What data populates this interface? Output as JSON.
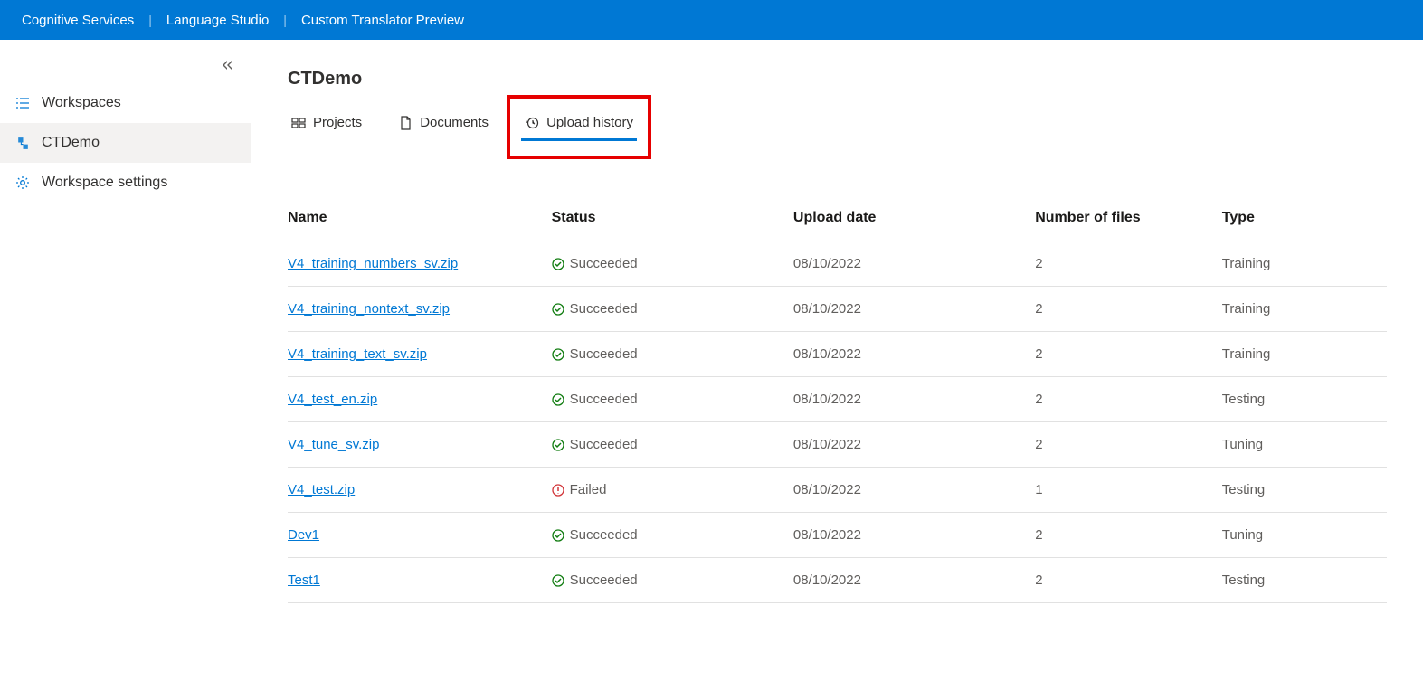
{
  "topbar": {
    "links": [
      "Cognitive Services",
      "Language Studio",
      "Custom Translator Preview"
    ]
  },
  "sidebar": {
    "items": [
      {
        "label": "Workspaces",
        "icon": "list"
      },
      {
        "label": "CTDemo",
        "icon": "translate",
        "active": true
      },
      {
        "label": "Workspace settings",
        "icon": "gear"
      }
    ]
  },
  "page": {
    "title": "CTDemo"
  },
  "tabs": [
    {
      "label": "Projects",
      "icon": "projects"
    },
    {
      "label": "Documents",
      "icon": "documents"
    },
    {
      "label": "Upload history",
      "icon": "history",
      "active": true,
      "highlighted": true
    }
  ],
  "table": {
    "headers": [
      "Name",
      "Status",
      "Upload date",
      "Number of files",
      "Type"
    ],
    "rows": [
      {
        "name": "V4_training_numbers_sv.zip",
        "status": "Succeeded",
        "ok": true,
        "date": "08/10/2022",
        "files": "2",
        "type": "Training"
      },
      {
        "name": "V4_training_nontext_sv.zip",
        "status": "Succeeded",
        "ok": true,
        "date": "08/10/2022",
        "files": "2",
        "type": "Training"
      },
      {
        "name": "V4_training_text_sv.zip",
        "status": "Succeeded",
        "ok": true,
        "date": "08/10/2022",
        "files": "2",
        "type": "Training"
      },
      {
        "name": "V4_test_en.zip",
        "status": "Succeeded",
        "ok": true,
        "date": "08/10/2022",
        "files": "2",
        "type": "Testing"
      },
      {
        "name": "V4_tune_sv.zip",
        "status": "Succeeded",
        "ok": true,
        "date": "08/10/2022",
        "files": "2",
        "type": "Tuning"
      },
      {
        "name": "V4_test.zip",
        "status": "Failed",
        "ok": false,
        "date": "08/10/2022",
        "files": "1",
        "type": "Testing"
      },
      {
        "name": "Dev1",
        "status": "Succeeded",
        "ok": true,
        "date": "08/10/2022",
        "files": "2",
        "type": "Tuning"
      },
      {
        "name": "Test1",
        "status": "Succeeded",
        "ok": true,
        "date": "08/10/2022",
        "files": "2",
        "type": "Testing"
      }
    ]
  }
}
